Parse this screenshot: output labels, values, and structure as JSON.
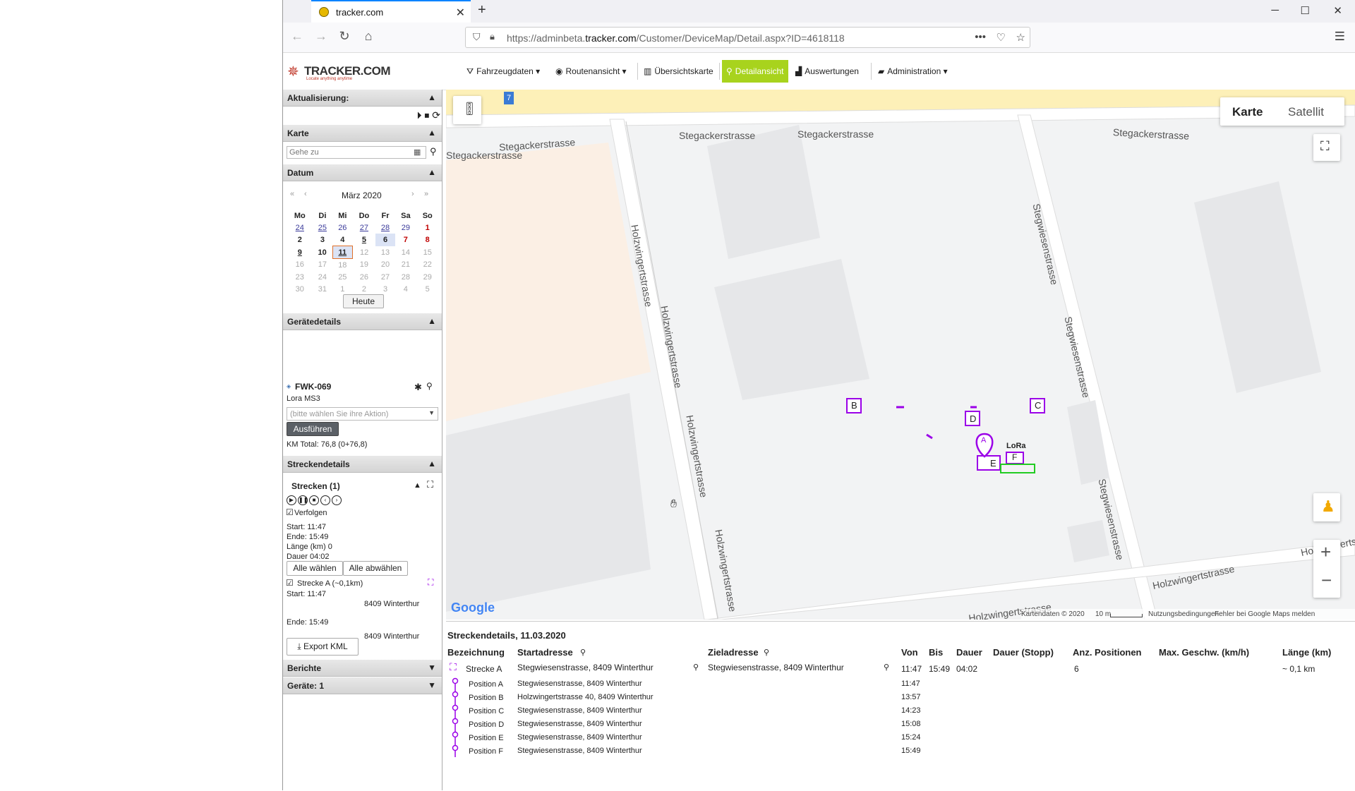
{
  "browser": {
    "tab_title": "tracker.com",
    "url_prefix": "https://adminbeta.",
    "url_domain": "tracker.com",
    "url_path": "/Customer/DeviceMap/Detail.aspx?ID=4618118"
  },
  "header": {
    "logo_text": "TRACKER.COM",
    "logo_sub": "Locate anything anytime",
    "menu": [
      {
        "label": "Fahrzeugdaten",
        "icon": "road-icon"
      },
      {
        "label": "Routenansicht",
        "icon": "compass-icon"
      },
      {
        "label": "Übersichtskarte",
        "icon": "map-icon"
      },
      {
        "label": "Detailansicht",
        "icon": "pin-icon"
      },
      {
        "label": "Auswertungen",
        "icon": "chart-icon"
      },
      {
        "label": "Administration",
        "icon": "folder-icon"
      }
    ]
  },
  "sidebar": {
    "aktualisierung": "Aktualisierung:",
    "karte": "Karte",
    "goto_placeholder": "Gehe zu",
    "datum": "Datum",
    "calendar": {
      "month": "März 2020",
      "weekdays": [
        "Mo",
        "Di",
        "Mi",
        "Do",
        "Fr",
        "Sa",
        "So"
      ],
      "weeks": [
        [
          "24",
          "25",
          "26",
          "27",
          "28",
          "29",
          "1"
        ],
        [
          "2",
          "3",
          "4",
          "5",
          "6",
          "7",
          "8"
        ],
        [
          "9",
          "10",
          "11",
          "12",
          "13",
          "14",
          "15"
        ],
        [
          "16",
          "17",
          "18",
          "19",
          "20",
          "21",
          "22"
        ],
        [
          "23",
          "24",
          "25",
          "26",
          "27",
          "28",
          "29"
        ],
        [
          "30",
          "31",
          "1",
          "2",
          "3",
          "4",
          "5"
        ]
      ],
      "today_button": "Heute"
    },
    "geraetedetails": "Gerätedetails",
    "device_name": "FWK-069",
    "device_type": "Lora MS3",
    "action_placeholder": "(bitte wählen Sie ihre Aktion)",
    "execute_button": "Ausführen",
    "km_total": "KM Total: 76,8 (0+76,8)",
    "streckendetails": "Streckendetails",
    "strecken_title": "Strecken (1)",
    "verfolgen": "Verfolgen",
    "start": "Start: 11:47",
    "ende": "Ende: 15:49",
    "laenge": "Länge (km) 0",
    "dauer": "Dauer 04:02",
    "select_all": "Alle wählen",
    "deselect_all": "Alle abwählen",
    "route_label": "Strecke A (~0,1km)",
    "route_start": "Start: 11:47",
    "route_start_addr": "8409 Winterthur",
    "route_end": "Ende: 15:49",
    "route_end_addr": "8409 Winterthur",
    "export_button": "Export KML",
    "berichte": "Berichte",
    "geraete": "Geräte: 1"
  },
  "map": {
    "type_map": "Karte",
    "type_satellite": "Satellit",
    "street_labels": [
      "Stegackerstrasse",
      "Stegackerstrasse",
      "Stegackerstrasse",
      "Stegackerstrasse",
      "Holzwingertstrasse",
      "Holzwingertstrasse",
      "Holzwingertstrasse",
      "Holzwingertstrasse",
      "Stegwiesenstrasse",
      "Stegwiesenstrasse",
      "Stegwiesenstrasse",
      "Holzwingertstrasse",
      "Holzwingertstrasse",
      "Holzwingertstrasse"
    ],
    "badge": "7",
    "markers": [
      "A",
      "B",
      "C",
      "D",
      "E",
      "F"
    ],
    "device_label": "LoRa",
    "google": "Google",
    "kartendaten": "Kartendaten © 2020",
    "scale": "10 m",
    "nutzung": "Nutzungsbedingungen",
    "fehler": "Fehler bei Google Maps melden",
    "zoom_in": "+",
    "zoom_out": "−"
  },
  "details": {
    "title": "Streckendetails, 11.03.2020",
    "columns": [
      "Bezeichnung",
      "Startadresse",
      "Zieladresse",
      "Von",
      "Bis",
      "Dauer",
      "Dauer (Stopp)",
      "Anz. Positionen",
      "Max. Geschw. (km/h)",
      "Länge (km)"
    ],
    "route": {
      "name": "Strecke A",
      "start": "Stegwiesenstrasse, 8409 Winterthur",
      "ziel": "Stegwiesenstrasse, 8409 Winterthur",
      "von": "11:47",
      "bis": "15:49",
      "dauer": "04:02",
      "positions": "6",
      "laenge": "~ 0,1 km"
    },
    "positions": [
      {
        "name": "Position A",
        "addr": "Stegwiesenstrasse, 8409 Winterthur",
        "time": "11:47"
      },
      {
        "name": "Position B",
        "addr": "Holzwingertstrasse 40, 8409 Winterthur",
        "time": "13:57"
      },
      {
        "name": "Position C",
        "addr": "Stegwiesenstrasse, 8409 Winterthur",
        "time": "14:23"
      },
      {
        "name": "Position D",
        "addr": "Stegwiesenstrasse, 8409 Winterthur",
        "time": "15:08"
      },
      {
        "name": "Position E",
        "addr": "Stegwiesenstrasse, 8409 Winterthur",
        "time": "15:24"
      },
      {
        "name": "Position F",
        "addr": "Stegwiesenstrasse, 8409 Winterthur",
        "time": "15:49"
      }
    ]
  },
  "colors": {
    "accent": "#a8d31d",
    "route": "#9b00e8",
    "today_border": "#e0702a",
    "weekend_red": "#c00000"
  }
}
